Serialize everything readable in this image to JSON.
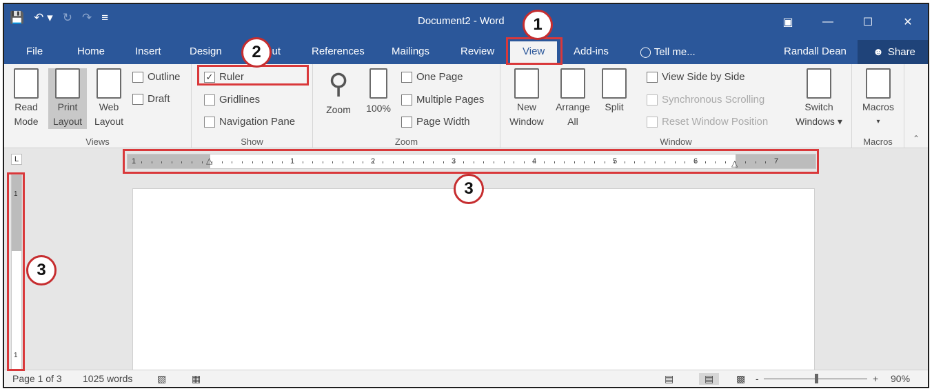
{
  "window": {
    "title": "Document2 - Word",
    "qat": {
      "save": "💾",
      "undo": "↶ ▾",
      "redo": "↻",
      "repeat": "↷",
      "customize": "≡"
    },
    "controls": {
      "ribbon_display": "▣",
      "minimize": "—",
      "maximize": "☐",
      "close": "✕"
    }
  },
  "tabs": [
    "File",
    "Home",
    "Insert",
    "Design",
    "Layout",
    "References",
    "Mailings",
    "Review",
    "View",
    "Add-ins"
  ],
  "active_tab": "View",
  "tell_me": "Tell me...",
  "user": "Randall Dean",
  "share": "Share",
  "ribbon": {
    "views": {
      "label": "Views",
      "read_mode": "Read Mode",
      "read_mode_l1": "Read",
      "read_mode_l2": "Mode",
      "print_layout_l1": "Print",
      "print_layout_l2": "Layout",
      "web_layout_l1": "Web",
      "web_layout_l2": "Layout",
      "outline": "Outline",
      "draft": "Draft"
    },
    "show": {
      "label": "Show",
      "ruler": "Ruler",
      "ruler_checked": true,
      "gridlines": "Gridlines",
      "navigation_pane": "Navigation Pane"
    },
    "zoom": {
      "label": "Zoom",
      "zoom": "Zoom",
      "hundred": "100%",
      "one_page": "One Page",
      "multiple_pages": "Multiple Pages",
      "page_width": "Page Width"
    },
    "window": {
      "label": "Window",
      "new_window_l1": "New",
      "new_window_l2": "Window",
      "arrange_all_l1": "Arrange",
      "arrange_all_l2": "All",
      "split": "Split",
      "view_side_by_side": "View Side by Side",
      "sync_scrolling": "Synchronous Scrolling",
      "reset_window": "Reset Window Position",
      "switch_l1": "Switch",
      "switch_l2": "Windows ▾"
    },
    "macros": {
      "label": "Macros",
      "macros": "Macros",
      "dropdown": "▾"
    }
  },
  "ruler": {
    "tab_selector": "L",
    "numbers": [
      "1",
      "1",
      "2",
      "3",
      "4",
      "5",
      "6",
      "7"
    ],
    "vertical_numbers": [
      "1",
      "1"
    ]
  },
  "status": {
    "page": "Page 1 of 3",
    "words": "1025 words",
    "zoom_minus": "-",
    "zoom_plus": "+",
    "zoom": "90%",
    "zoom_level_percent": 90
  },
  "callouts": {
    "c1": "1",
    "c2": "2",
    "c3a": "3",
    "c3b": "3"
  },
  "colors": {
    "title_bar": "#2b579a",
    "highlight": "#d9383a"
  }
}
